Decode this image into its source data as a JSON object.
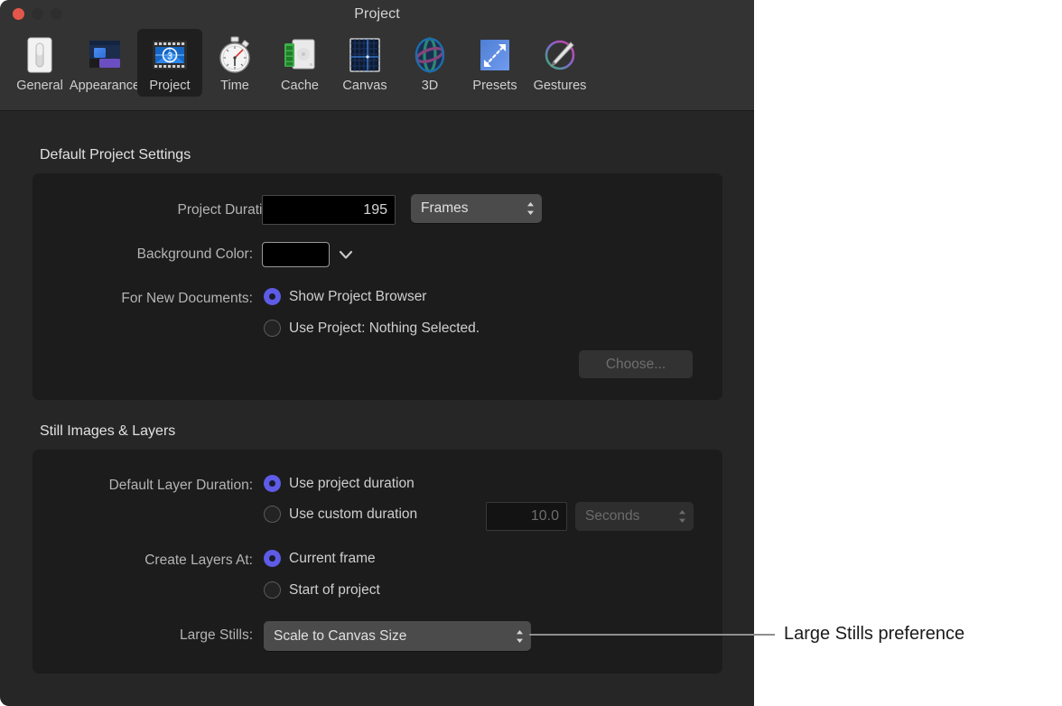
{
  "window": {
    "title": "Project",
    "traffic_lights": [
      "close-button",
      "minimize-button",
      "maximize-button"
    ]
  },
  "toolbar": {
    "items": [
      {
        "label": "General",
        "icon": "general-switch-icon",
        "selected": false
      },
      {
        "label": "Appearance",
        "icon": "appearance-window-icon",
        "selected": false
      },
      {
        "label": "Project",
        "icon": "project-film-icon",
        "selected": true
      },
      {
        "label": "Time",
        "icon": "time-stopwatch-icon",
        "selected": false
      },
      {
        "label": "Cache",
        "icon": "cache-memory-icon",
        "selected": false
      },
      {
        "label": "Canvas",
        "icon": "canvas-grid-icon",
        "selected": false
      },
      {
        "label": "3D",
        "icon": "three-d-globe-icon",
        "selected": false
      },
      {
        "label": "Presets",
        "icon": "presets-resize-icon",
        "selected": false
      },
      {
        "label": "Gestures",
        "icon": "gestures-pen-icon",
        "selected": false
      }
    ]
  },
  "sections": {
    "default_project": {
      "title": "Default Project Settings",
      "project_duration": {
        "label": "Project Duration:",
        "value": "195",
        "units_value": "Frames"
      },
      "background_color": {
        "label": "Background Color:",
        "swatch_color": "#000000"
      },
      "for_new_documents": {
        "label": "For New Documents:",
        "options": [
          {
            "label": "Show Project Browser",
            "selected": true
          },
          {
            "label": "Use Project: Nothing Selected.",
            "selected": false
          }
        ],
        "choose_button": "Choose...",
        "choose_enabled": false
      }
    },
    "still_images": {
      "title": "Still Images & Layers",
      "default_layer_duration": {
        "label": "Default Layer Duration:",
        "options": [
          {
            "label": "Use project duration",
            "selected": true
          },
          {
            "label": "Use custom duration",
            "selected": false
          }
        ],
        "custom_value": "10.0",
        "custom_units": "Seconds",
        "custom_enabled": false
      },
      "create_layers_at": {
        "label": "Create Layers At:",
        "options": [
          {
            "label": "Current frame",
            "selected": true
          },
          {
            "label": "Start of project",
            "selected": false
          }
        ]
      },
      "large_stills": {
        "label": "Large Stills:",
        "value": "Scale to Canvas Size"
      }
    }
  },
  "callout": {
    "text": "Large Stills preference"
  },
  "colors": {
    "accent_radio": "#5e5ce6",
    "window_background": "#262626",
    "titlebar": "#333333",
    "groupbox": "#1c1c1c",
    "close_light": "#e4564b"
  }
}
